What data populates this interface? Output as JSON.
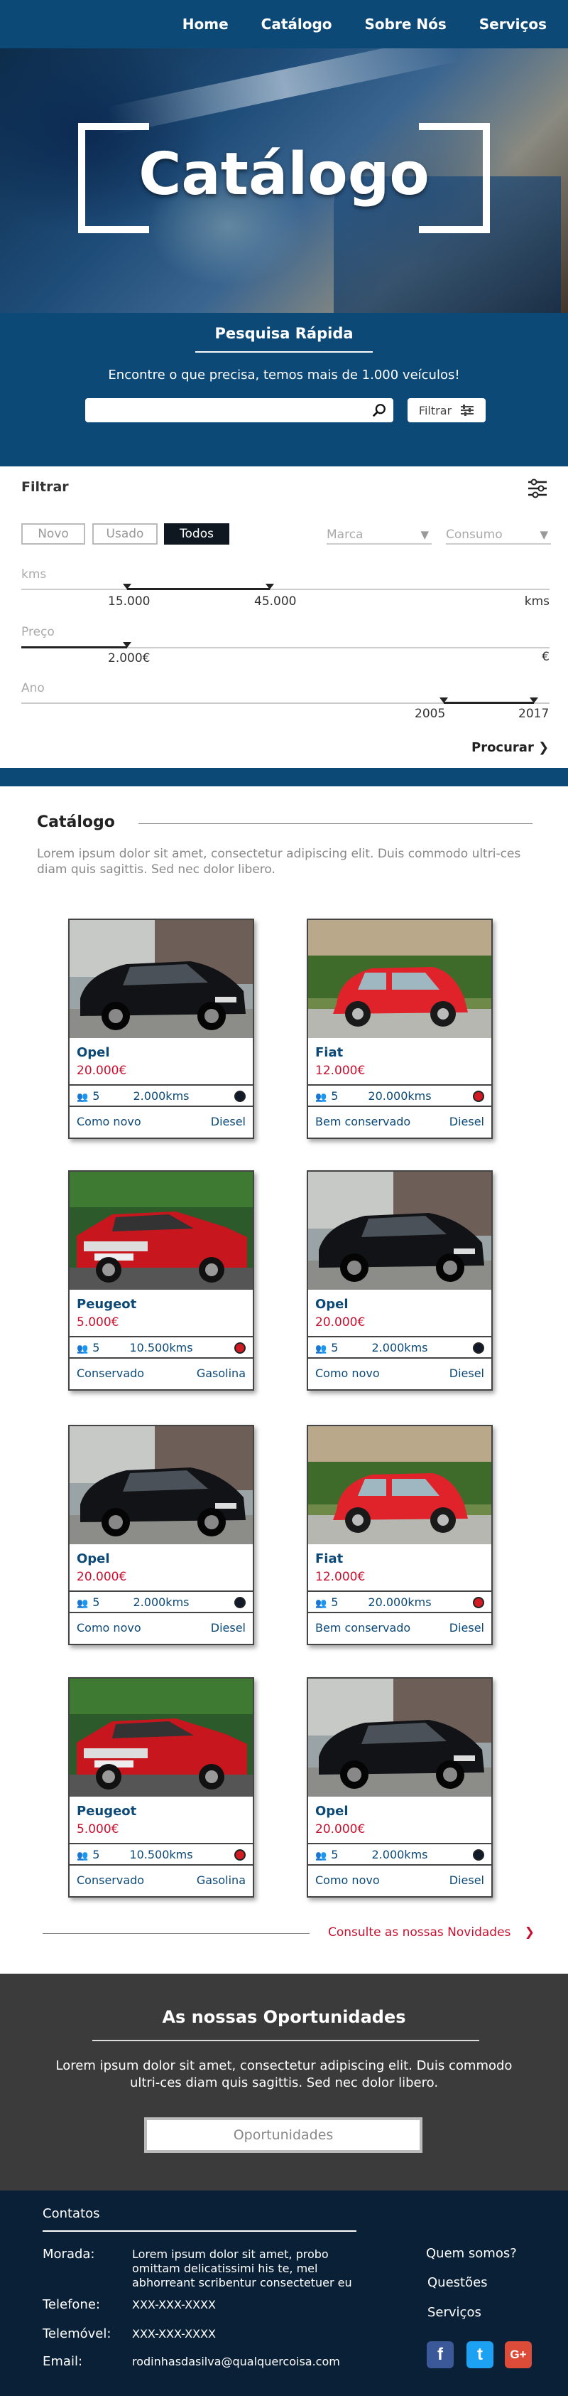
{
  "nav": {
    "items": [
      "Home",
      "Catálogo",
      "Sobre Nós",
      "Serviços"
    ]
  },
  "hero": {
    "title": "Catálogo"
  },
  "quick_search": {
    "title": "Pesquisa Rápida",
    "subtitle": "Encontre o que precisa, temos mais de 1.000 veículos!",
    "search_placeholder": "",
    "filter_label": "Filtrar"
  },
  "filters": {
    "title": "Filtrar",
    "segments": [
      "Novo",
      "Usado",
      "Todos"
    ],
    "active_segment": "Todos",
    "dropdowns": [
      "Marca",
      "Consumo"
    ],
    "kms": {
      "label": "kms",
      "min": "15.000",
      "max": "45.000",
      "unit": "kms",
      "min_fraction": 0.2,
      "max_fraction": 0.47
    },
    "preco": {
      "label": "Preço",
      "value": "2.000€",
      "unit": "€",
      "fraction": 0.2
    },
    "ano": {
      "label": "Ano",
      "min": "2005",
      "max": "2017",
      "min_fraction": 0.8,
      "max_fraction": 0.97
    },
    "search_label": "Procurar"
  },
  "catalog": {
    "title": "Catálogo",
    "description": "Lorem ipsum dolor sit amet, consectetur adipiscing elit. Duis commodo ultri-ces diam quis sagittis. Sed nec dolor libero.",
    "cards": [
      {
        "brand": "Opel",
        "price": "20.000€",
        "seats": "5",
        "kms": "2.000kms",
        "condition": "Como novo",
        "fuel": "Diesel",
        "color": "#111a28",
        "car": "black"
      },
      {
        "brand": "Fiat",
        "price": "12.000€",
        "seats": "5",
        "kms": "20.000kms",
        "condition": "Bem conservado",
        "fuel": "Diesel",
        "color": "#d01a24",
        "car": "fiat"
      },
      {
        "brand": "Peugeot",
        "price": "5.000€",
        "seats": "5",
        "kms": "10.500kms",
        "condition": "Conservado",
        "fuel": "Gasolina",
        "color": "#d01a24",
        "car": "peugeot"
      },
      {
        "brand": "Opel",
        "price": "20.000€",
        "seats": "5",
        "kms": "2.000kms",
        "condition": "Como novo",
        "fuel": "Diesel",
        "color": "#111a28",
        "car": "black"
      },
      {
        "brand": "Opel",
        "price": "20.000€",
        "seats": "5",
        "kms": "2.000kms",
        "condition": "Como novo",
        "fuel": "Diesel",
        "color": "#111a28",
        "car": "black"
      },
      {
        "brand": "Fiat",
        "price": "12.000€",
        "seats": "5",
        "kms": "20.000kms",
        "condition": "Bem conservado",
        "fuel": "Diesel",
        "color": "#d01a24",
        "car": "fiat"
      },
      {
        "brand": "Peugeot",
        "price": "5.000€",
        "seats": "5",
        "kms": "10.500kms",
        "condition": "Conservado",
        "fuel": "Gasolina",
        "color": "#d01a24",
        "car": "peugeot"
      },
      {
        "brand": "Opel",
        "price": "20.000€",
        "seats": "5",
        "kms": "2.000kms",
        "condition": "Como novo",
        "fuel": "Diesel",
        "color": "#111a28",
        "car": "black"
      }
    ],
    "more_link": "Consulte as nossas Novidades"
  },
  "opportunities": {
    "title": "As nossas Oportunidades",
    "description": "Lorem ipsum dolor sit amet, consectetur adipiscing elit. Duis commodo ultri-ces diam quis sagittis. Sed nec dolor libero.",
    "button": "Oportunidades"
  },
  "footer": {
    "contacts_title": "Contatos",
    "morada_label": "Morada:",
    "morada_value": "Lorem ipsum dolor sit amet, probo omittam delicatissimi his te, mel abhorreant scribentur consectetuer eu",
    "telefone_label": "Telefone:",
    "telefone_value": "XXX-XXX-XXXX",
    "telemovel_label": "Telemóvel:",
    "telemovel_value": "XXX-XXX-XXXX",
    "email_label": "Email:",
    "email_value": "rodinhasdasilva@qualquercoisa.com",
    "links": [
      "Quem somos?",
      "Questões",
      "Serviços"
    ],
    "social": [
      {
        "icon": "facebook-icon",
        "glyph": "f",
        "color": "#3b5998"
      },
      {
        "icon": "twitter-icon",
        "glyph": "t",
        "color": "#1da1f2"
      },
      {
        "icon": "google-plus-icon",
        "glyph": "G+",
        "color": "#dd4b39"
      }
    ]
  },
  "colors": {
    "primary": "#0c4977",
    "accent": "#c8102e",
    "dark": "#3b3b3b",
    "footer": "#0a2036"
  }
}
